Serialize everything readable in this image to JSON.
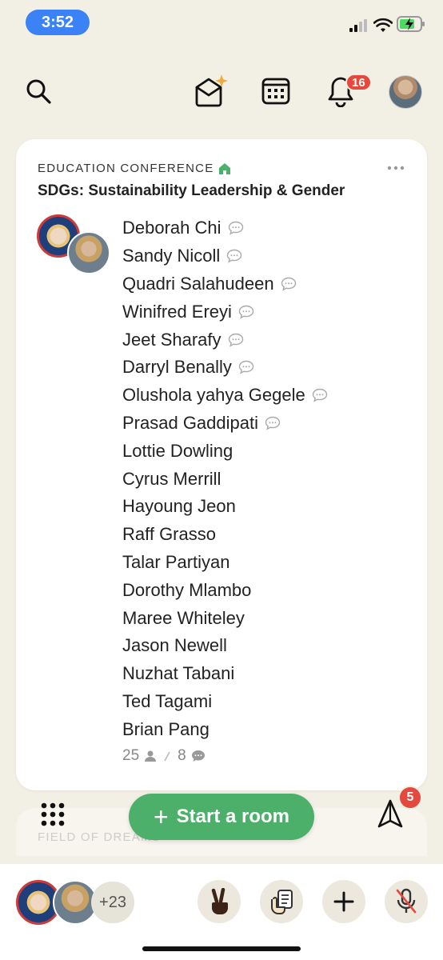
{
  "status_bar": {
    "time": "3:52"
  },
  "top_nav": {
    "notification_count": "16"
  },
  "room": {
    "club_name": "EDUCATION CONFERENCE",
    "title": "SDGs: Sustainability Leadership & Gender",
    "speakers": [
      {
        "name": "Deborah Chi",
        "chat": true
      },
      {
        "name": "Sandy Nicoll",
        "chat": true
      },
      {
        "name": "Quadri Salahudeen",
        "chat": true
      },
      {
        "name": "Winifred Ereyi",
        "chat": true
      },
      {
        "name": "Jeet Sharafy",
        "chat": true
      },
      {
        "name": "Darryl Benally",
        "chat": true
      },
      {
        "name": "Olushola yahya Gegele",
        "chat": true
      },
      {
        "name": "Prasad Gaddipati",
        "chat": true
      },
      {
        "name": "Lottie Dowling",
        "chat": false
      },
      {
        "name": "Cyrus Merrill",
        "chat": false
      },
      {
        "name": "Hayoung Jeon",
        "chat": false
      },
      {
        "name": "Raff Grasso",
        "chat": false
      },
      {
        "name": "Talar Partiyan",
        "chat": false
      },
      {
        "name": "Dorothy Mlambo",
        "chat": false
      },
      {
        "name": "Maree Whiteley",
        "chat": false
      },
      {
        "name": "Jason Newell",
        "chat": false
      },
      {
        "name": "Nuzhat Tabani",
        "chat": false
      },
      {
        "name": "Ted Tagami",
        "chat": false
      },
      {
        "name": "Brian Pang",
        "chat": false
      }
    ],
    "listener_count": "25",
    "speaker_count": "8"
  },
  "next_card": {
    "club_name_partial": "FIELD OF DREAMS"
  },
  "actions": {
    "start_room_label": "Start a room",
    "send_badge_count": "5"
  },
  "bottom_bar": {
    "more_count": "+23"
  },
  "colors": {
    "background": "#f2efe4",
    "accent_green": "#4caf6a",
    "badge_red": "#e5493d",
    "status_blue": "#3b82f6"
  }
}
